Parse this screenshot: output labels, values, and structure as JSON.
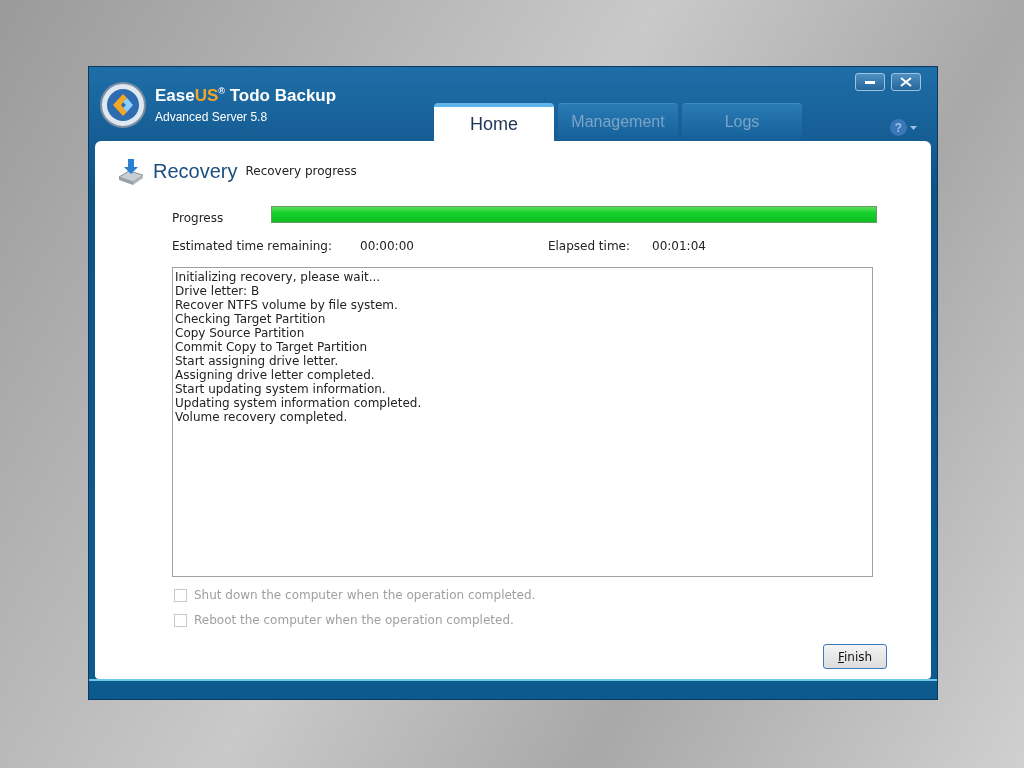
{
  "window": {
    "app_name": "Ease",
    "app_name_accent": "US",
    "registered": "®",
    "product": "Todo Backup",
    "edition": "Advanced Server 5.8"
  },
  "tabs": [
    {
      "label": "Home",
      "selected": true
    },
    {
      "label": "Management",
      "selected": false
    },
    {
      "label": "Logs",
      "selected": false
    }
  ],
  "help": {
    "label": "?"
  },
  "section": {
    "title": "Recovery",
    "subtitle": "Recovery progress"
  },
  "progress": {
    "label": "Progress",
    "level": 1.0
  },
  "times": [
    {
      "label": "Estimated time remaining:",
      "value": "00:00:00"
    },
    {
      "label": "Elapsed time:",
      "value": "00:01:04"
    }
  ],
  "log": [
    "Initializing recovery, please wait...",
    "Drive letter: B",
    "Recover NTFS volume by file system.",
    "Checking Target Partition",
    "Copy Source Partition",
    "Commit Copy to Target Partition",
    "Start assigning drive letter.",
    "Assigning drive letter completed.",
    "Start updating system information.",
    "Updating system information completed.",
    "Volume recovery completed."
  ],
  "options": [
    {
      "label": "Shut down the computer when the operation completed.",
      "checked": false,
      "disabled": true
    },
    {
      "label": "Reboot the computer when the operation completed.",
      "checked": false,
      "disabled": true
    }
  ],
  "buttons": [
    {
      "label": "Finish"
    }
  ]
}
